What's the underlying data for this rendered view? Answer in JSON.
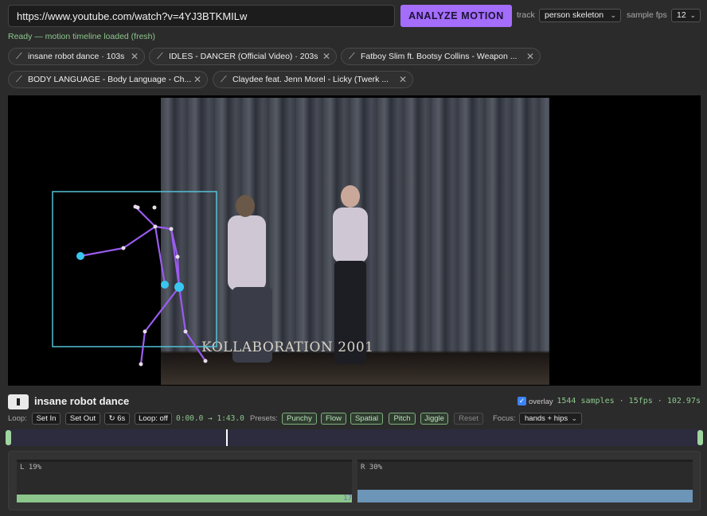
{
  "topbar": {
    "url_value": "https://www.youtube.com/watch?v=4YJ3BTKMILw",
    "analyze_label": "ANALYZE MOTION",
    "track_label": "track",
    "track_value": "person skeleton",
    "fps_label": "sample fps",
    "fps_value": "12"
  },
  "status": "Ready — motion timeline loaded (fresh)",
  "chips": [
    {
      "label": "insane robot dance · 103s"
    },
    {
      "label": "IDLES - DANCER (Official Video) · 203s"
    },
    {
      "label": "Fatboy Slim ft. Bootsy Collins - Weapon ..."
    },
    {
      "label": "BODY LANGUAGE - Body Language - Ch..."
    },
    {
      "label": "Claydee feat. Jenn Morel - Licky (Twerk ..."
    }
  ],
  "video": {
    "watermark": "KOLLABORATION 2001",
    "overlay_color": "#9a5cf0",
    "joint_color": "#39c6f0",
    "box_color": "#53c1d6"
  },
  "playbar": {
    "title": "insane robot dance",
    "overlay_label": "overlay",
    "overlay_checked": true,
    "stats": "1544 samples · 15fps · 102.97s"
  },
  "controls": {
    "loop_label": "Loop:",
    "set_in": "Set In",
    "set_out": "Set Out",
    "loop6": "↻ 6s",
    "loop_off": "Loop: off",
    "range": "0:00.0 → 1:43.0",
    "presets_label": "Presets:",
    "presets": [
      "Punchy",
      "Flow",
      "Spatial",
      "Pitch",
      "Jiggle"
    ],
    "reset": "Reset",
    "focus_label": "Focus:",
    "focus_value": "hands + hips"
  },
  "timeline": {
    "playhead_fraction": 0.315
  },
  "meters": {
    "left_label": "L 19%",
    "left_value": 0.19,
    "left_color": "#8cc68c",
    "left_readout": "17",
    "right_label": "R 30%",
    "right_value": 0.3,
    "right_color": "#6d95b8"
  }
}
